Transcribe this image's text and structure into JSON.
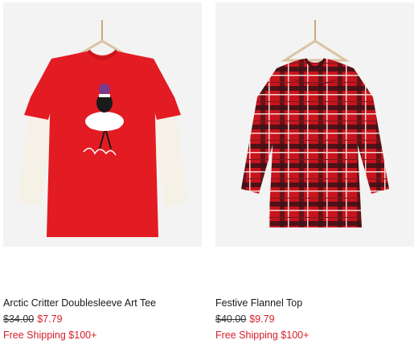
{
  "products": [
    {
      "name": "Arctic Critter Doublesleeve Art Tee",
      "original_price": "$34.00",
      "sale_price": "$7.79",
      "shipping": "Free Shipping $100+",
      "image_icon": "red-doublesleeve-tee-with-penguin-image",
      "colors": {
        "shirt": "#e31b23",
        "sleeves": "#f6f1e6"
      }
    },
    {
      "name": "Festive Flannel Top",
      "original_price": "$40.00",
      "sale_price": "$9.79",
      "shipping": "Free Shipping $100+",
      "image_icon": "red-plaid-flannel-top-image",
      "colors": {
        "base": "#c8141d",
        "dark": "#3a1216",
        "light": "#f3d6d2"
      }
    }
  ],
  "colors": {
    "sale": "#d51e28",
    "image_bg": "#f3f3f3"
  }
}
